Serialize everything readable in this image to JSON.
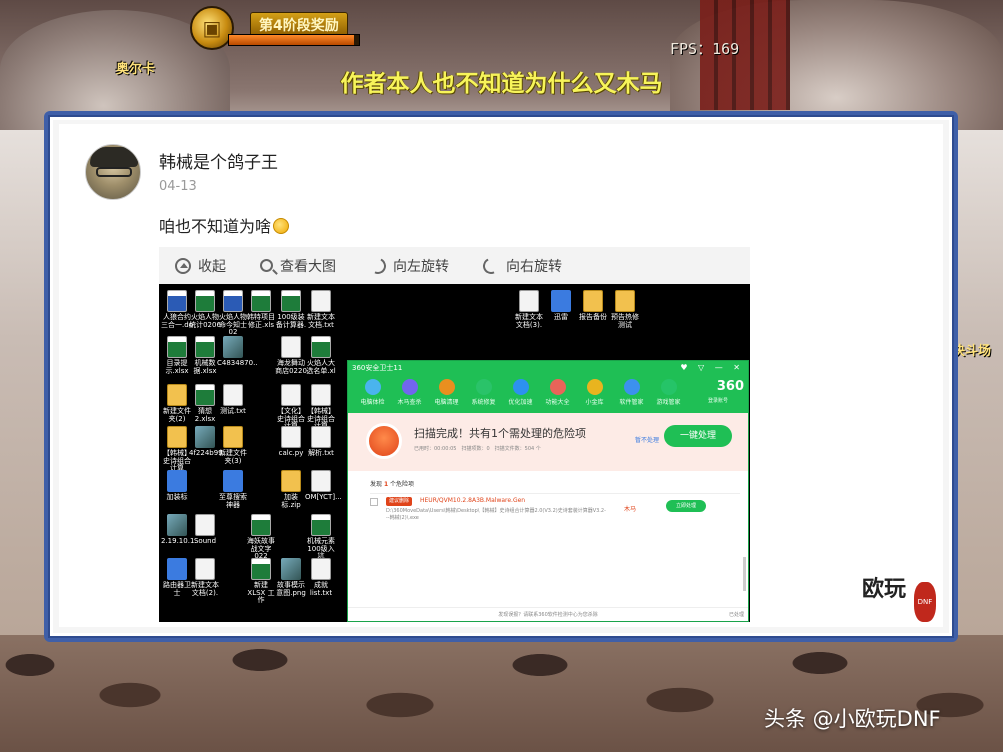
{
  "game_hud": {
    "stage_label": "第4阶段奖励",
    "npc_name": "奥尔卡",
    "fps": "FPS：169",
    "right_sign": "决斗场"
  },
  "caption": "作者本人也不知道为什么又木马",
  "post": {
    "username": "韩械是个鸽子王",
    "date": "04-13",
    "text": "咱也不知道为啥"
  },
  "viewer_toolbar": {
    "collapse": "收起",
    "view_large": "查看大图",
    "rotate_left": "向左旋转",
    "rotate_right": "向右旋转"
  },
  "desktop": {
    "icons": [
      "人狼合约三合一.docx",
      "火焰人物统计0206.xlsx",
      "火焰人物命今知士0205.xlsx",
      "韩特项目修正.xlsx",
      "100级装备计算器.xlsx",
      "新建文本文档.txt",
      "新建文本文档(3).txt",
      "迅雷",
      "报告备份",
      "预告热修测试",
      "目录提示.xlsx",
      "机械数据.xlsx",
      "C4834870...",
      "海龙舞动商店0220.txt",
      "火焰人大选名单.xlsx",
      "新建文件夹(2)",
      "猜想2.xlsx",
      "测试.txt",
      "【文化】史诗组合计算器.xlsx",
      "【韩械】史诗组合计算器.xlsx",
      "【韩械】史诗组合计算器",
      "4f224b99...",
      "新建文件夹(3)",
      "calc.py",
      "解析.txt",
      "加装标",
      "至尊搜索神器",
      "加装标.zip",
      "OM[YCT]...",
      "2.19.10.1...",
      "Sound",
      "海妖故事战文字0221.xlsx",
      "机械元素100级入坑...",
      "路由器卫士",
      "新建文本文档(2).txt",
      "新建 XLSX 工作表.xlsx",
      "故事模示意图.png",
      "成就list.txt"
    ]
  },
  "antivirus": {
    "title": "360安全卫士11",
    "nav": [
      "电脑体检",
      "木马查杀",
      "电脑清理",
      "系统修复",
      "优化加速",
      "功能大全",
      "小金库",
      "软件管家",
      "游戏管家"
    ],
    "logo": "360",
    "logo_sub": "登录账号",
    "result_title": "扫描完成！共有1个需处理的危险项",
    "result_sub": "已用时：00:00:05　扫描项数：0　扫描文件数：504 个",
    "skip": "暂不处理",
    "fix_all": "一键处理",
    "found_prefix": "发现",
    "found_count": "1",
    "found_suffix": "个危险项",
    "row": {
      "tag": "建议删除",
      "virus": "HEUR/QVM10.2.8A3B.Malware.Gen",
      "path": "D:\\360MoveData\\Users\\韩械\\Desktop\\【韩械】史诗组合计算器2.0(V3.2)史诗套装计算器V3.2---韩械(2)\\.exe",
      "type": "木马",
      "action": "立即处理"
    },
    "footer": "发现误报？请联系360软件检测中心为您杀除",
    "footer_right": "已处理"
  },
  "watermark": {
    "brand": "欧玩",
    "seal": "DNF",
    "source": "头条 @小欧玩DNF"
  },
  "colors": {
    "frame_blue": "#3f5fa8",
    "caption_yellow": "#f7f45a",
    "av_green": "#1fbf55",
    "danger_orange": "#e0441a"
  }
}
